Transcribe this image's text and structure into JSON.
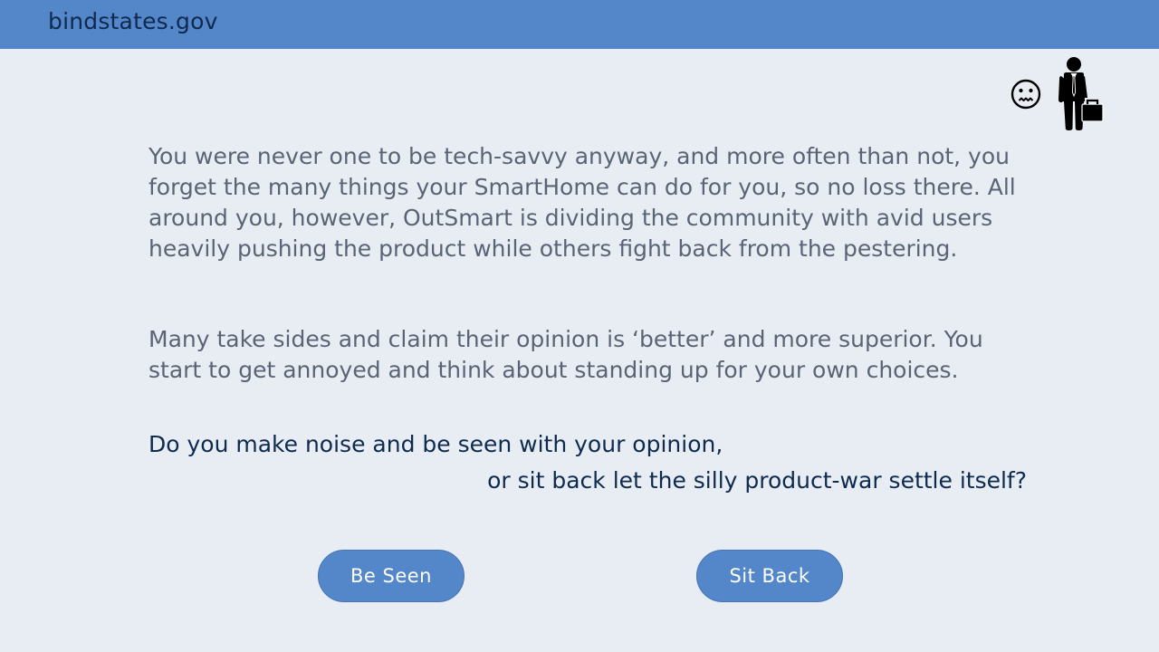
{
  "header": {
    "site_title": "bindstates.gov"
  },
  "status": {
    "mood_icon": "worried-face-icon",
    "character_icon": "businessman-with-briefcase-icon"
  },
  "story": {
    "paragraph1": "You were never one to be tech-savvy anyway, and more often than not, you forget the many things your SmartHome can do for you, so no loss there. All around you, however, OutSmart is dividing the community with avid users heavily pushing the product while others fight back from the pestering.",
    "paragraph2": "Many take sides and claim their opinion is ‘better’ and more superior. You start to get annoyed and think about standing up for your own choices."
  },
  "question": {
    "line1": "Do you make noise and be seen with your opinion,",
    "line2": "or sit back let the silly product-war settle itself?"
  },
  "choices": {
    "option1": "Be Seen",
    "option2": "Sit Back"
  },
  "colors": {
    "header_bg": "#5487c9",
    "page_bg": "#e7edf2",
    "body_text": "#5b6475",
    "question_text": "#0e2a4e",
    "button_bg": "#5487c9"
  }
}
